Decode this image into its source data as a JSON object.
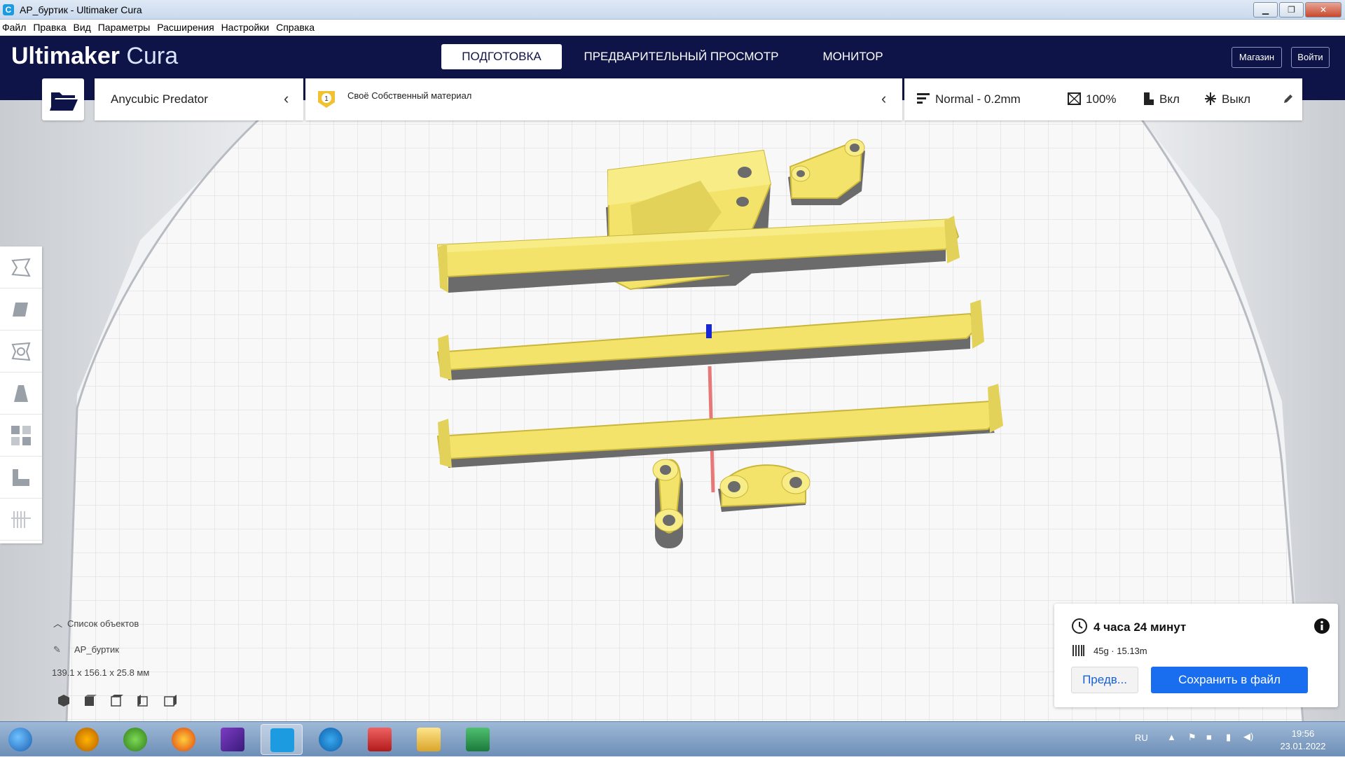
{
  "window": {
    "title": "AP_буртик - Ultimaker Cura"
  },
  "menu": [
    "Файл",
    "Правка",
    "Вид",
    "Параметры",
    "Расширения",
    "Настройки",
    "Справка"
  ],
  "header": {
    "logo_bold": "Ultimaker",
    "logo_light": "Cura",
    "tabs": [
      "ПОДГОТОВКА",
      "ПРЕДВАРИТЕЛЬНЫЙ ПРОСМОТР",
      "МОНИТОР"
    ],
    "market": "Магазин",
    "login": "Войти"
  },
  "toolbar": {
    "printer": "Anycubic Predator",
    "extruder_number": "1",
    "material": "Своё Собственный материал",
    "profile": "Normal - 0.2mm",
    "infill": "100%",
    "support": "Вкл",
    "adhesion": "Выкл"
  },
  "object_list": {
    "title": "Список объектов",
    "object_name": "AP_буртик",
    "dimensions": "139.1 x 156.1 x 25.8 мм"
  },
  "print_panel": {
    "time": "4 часа 24 минут",
    "material_usage": "45g · 15.13m",
    "preview_button": "Предв...",
    "save_button": "Сохранить в файл"
  },
  "tray": {
    "language": "RU",
    "time": "19:56",
    "date": "23.01.2022"
  },
  "colors": {
    "header": "#0f1448",
    "model": "#f4e36a",
    "accent": "#196ef0"
  }
}
